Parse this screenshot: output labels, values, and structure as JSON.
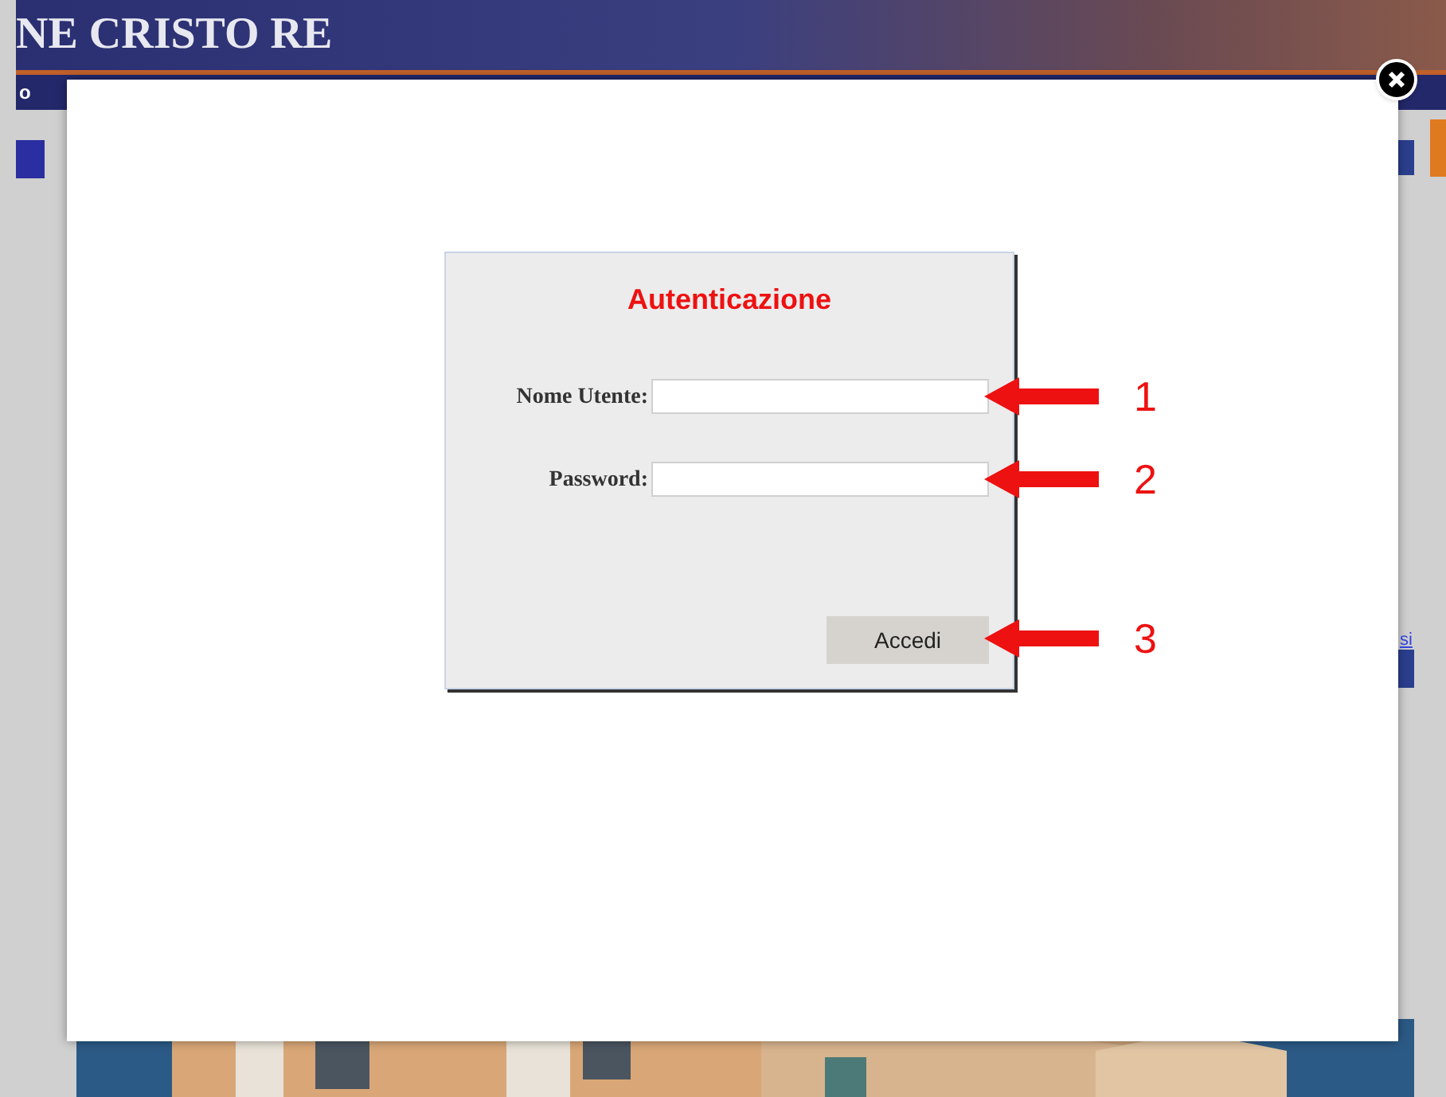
{
  "page": {
    "banner_title": "NE CRISTO RE",
    "nav_text": "o",
    "side_link": "si"
  },
  "dialog": {
    "title": "Autenticazione",
    "fields": [
      {
        "label": "Nome Utente:",
        "annotation": "1"
      },
      {
        "label": "Password:",
        "annotation": "2"
      }
    ],
    "submit": {
      "label": "Accedi",
      "annotation": "3"
    }
  }
}
